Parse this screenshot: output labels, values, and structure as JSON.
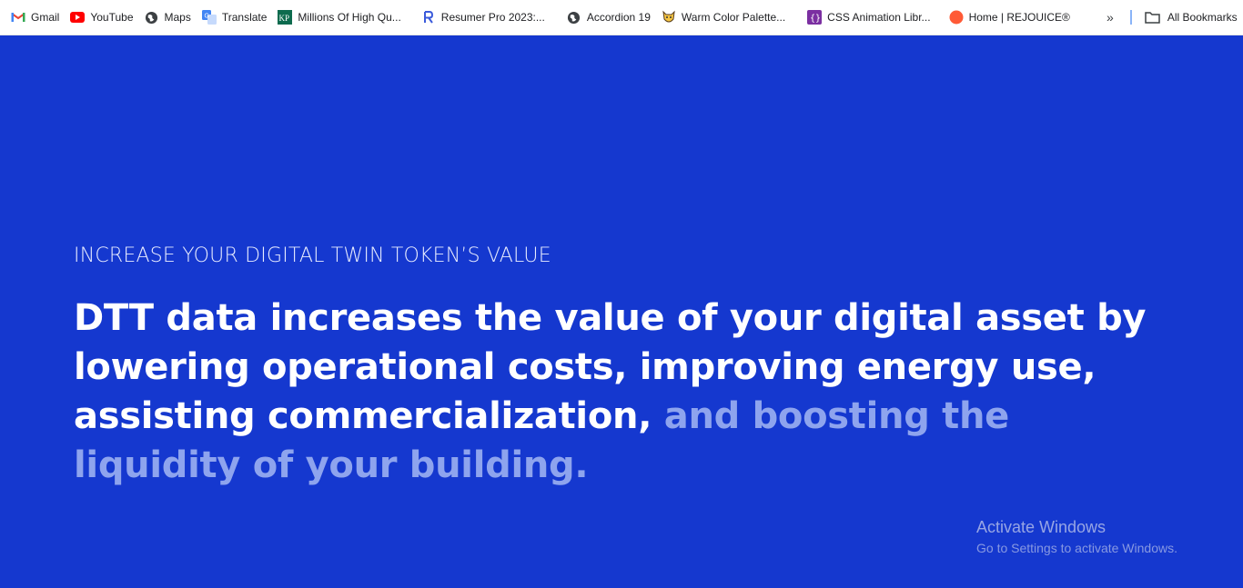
{
  "bookmarks": [
    {
      "label": "Gmail",
      "icon": "gmail-icon"
    },
    {
      "label": "YouTube",
      "icon": "youtube-icon"
    },
    {
      "label": "Maps",
      "icon": "globe-icon"
    },
    {
      "label": "Translate",
      "icon": "translate-icon"
    },
    {
      "label": "Millions Of High Qu...",
      "icon": "kp-icon"
    },
    {
      "label": "Resumer Pro 2023:...",
      "icon": "resumer-icon"
    },
    {
      "label": "Accordion 19",
      "icon": "globe-icon"
    },
    {
      "label": "Warm Color Palette...",
      "icon": "palette-icon"
    },
    {
      "label": "CSS Animation Libr...",
      "icon": "braces-icon"
    },
    {
      "label": "Home | REJOUICE®",
      "icon": "circle-icon"
    }
  ],
  "more_label": "»",
  "all_bookmarks_label": "All Bookmarks",
  "hero": {
    "eyebrow": "INCREASE YOUR DIGITAL TWIN TOKEN’S VALUE",
    "headline_main": "DTT data increases the value of your digital asset by lowering operational costs, improving energy use, assisting commercialization,",
    "headline_muted": "and boosting the liquidity of your building."
  },
  "watermark": {
    "title": "Activate Windows",
    "subtitle": "Go to Settings to activate Windows."
  },
  "colors": {
    "background": "#1538cf",
    "text": "#ffffff",
    "muted_text": "#8ea4ee"
  }
}
